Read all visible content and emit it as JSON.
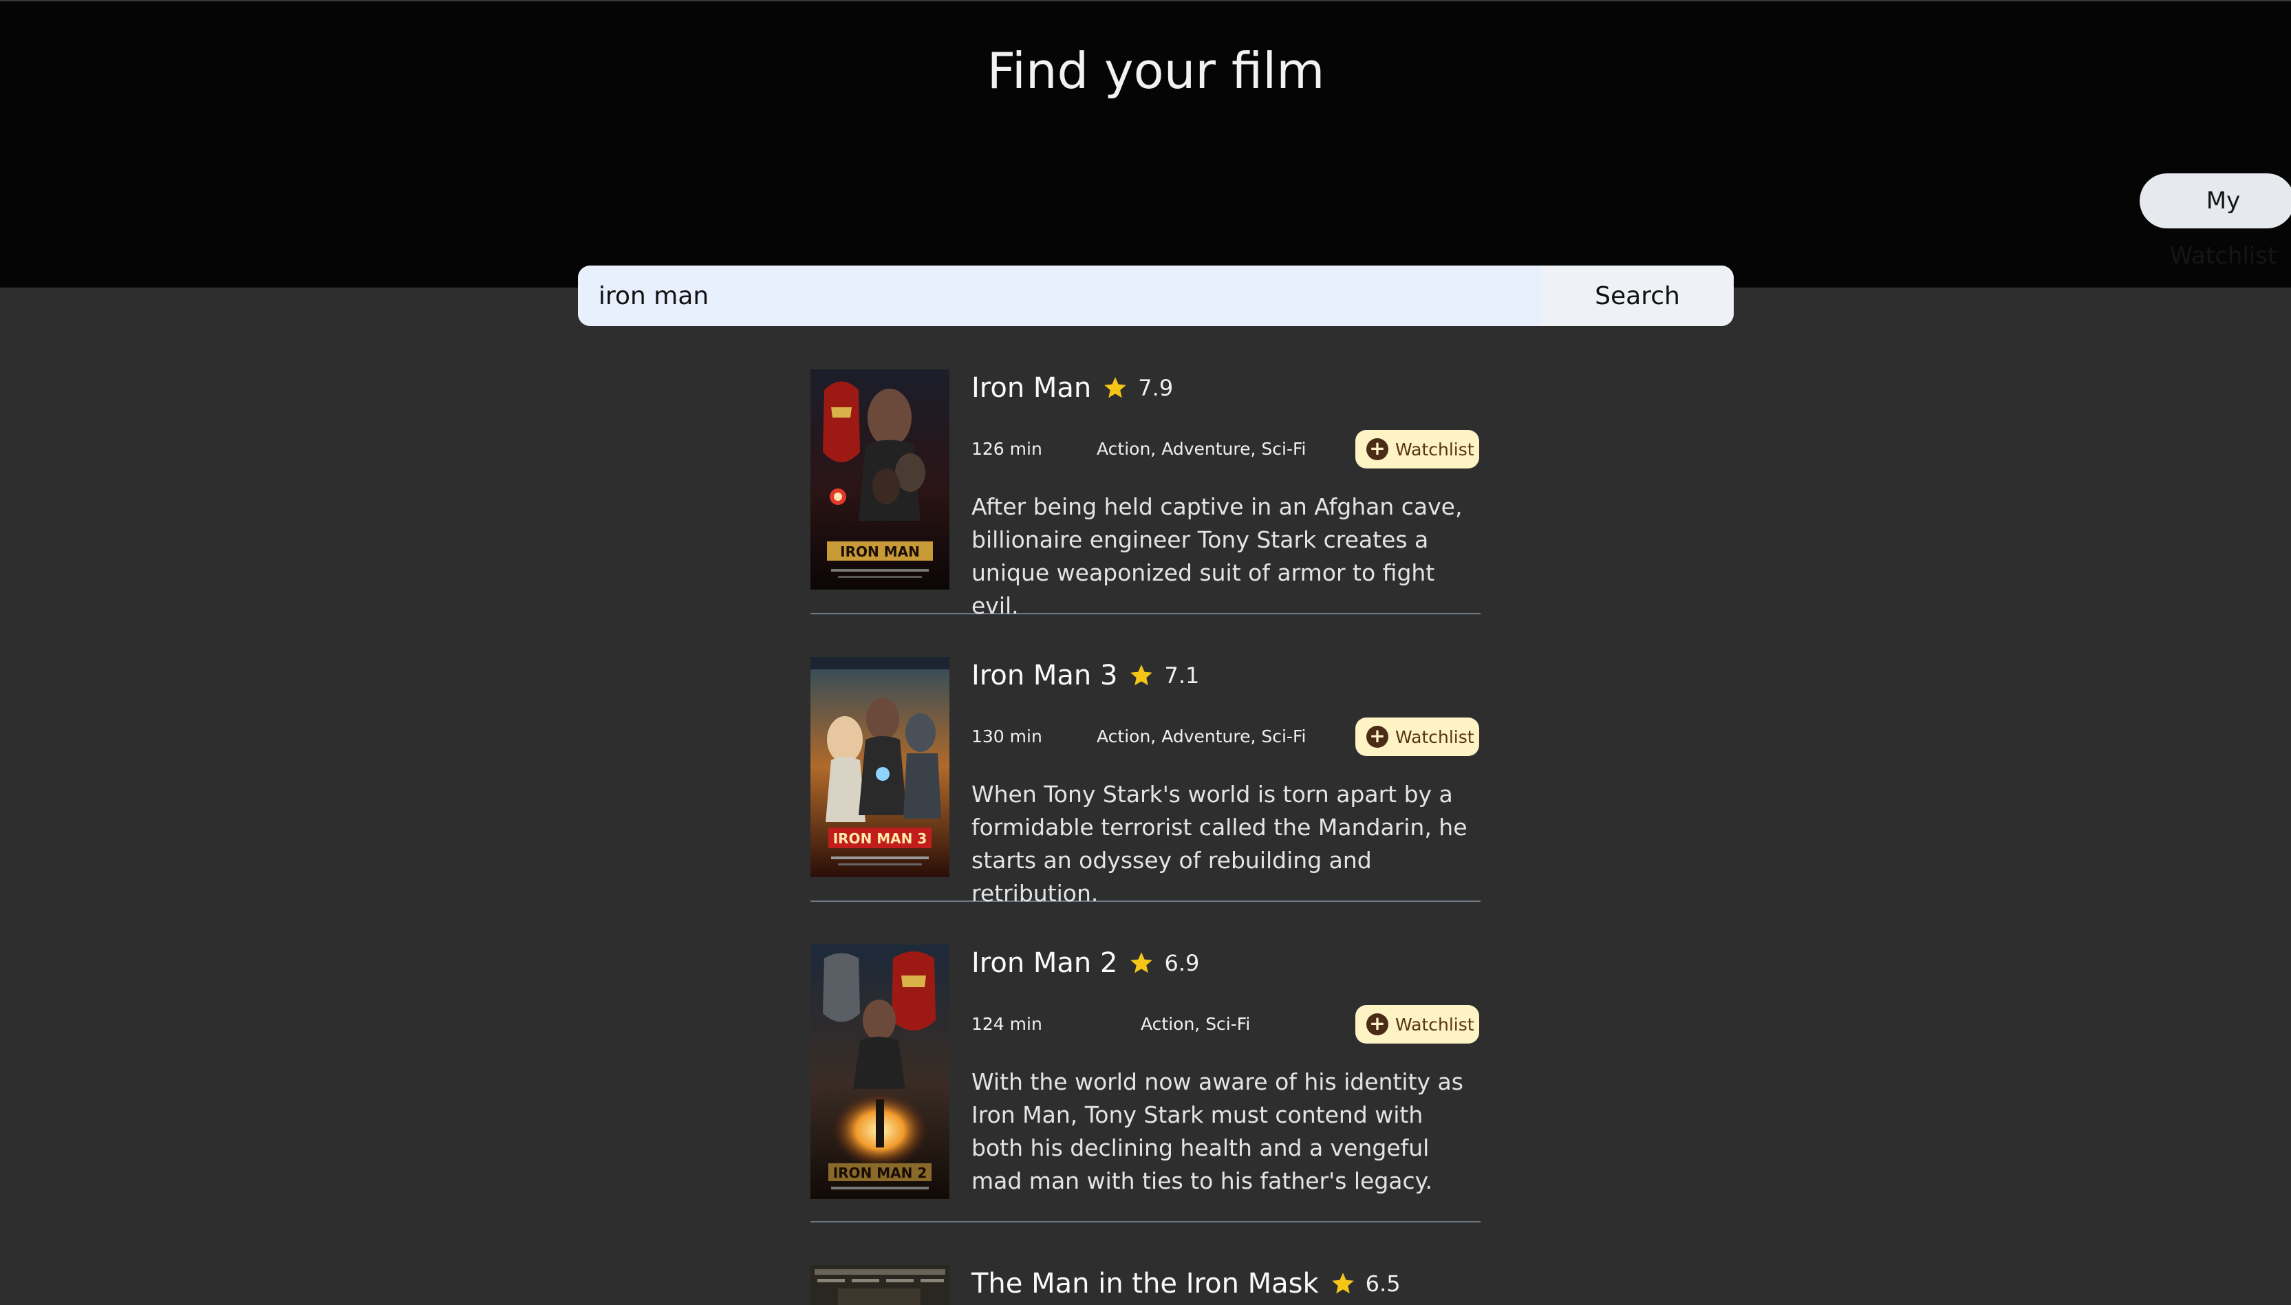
{
  "page": {
    "title": "Find your film",
    "watchlist_button": "My Watchlist"
  },
  "search": {
    "value": "iron man",
    "button_label": "Search"
  },
  "colors": {
    "header_bg": "#050505",
    "page_bg": "#2e2e2e",
    "star": "#f5c518",
    "watchlist_chip_bg": "#fdf3c4"
  },
  "results": [
    {
      "title": "Iron Man",
      "rating": "7.9",
      "runtime": "126 min",
      "genres": "Action, Adventure, Sci-Fi",
      "add_label": "Watchlist",
      "overview": "After being held captive in an Afghan cave, billionaire engineer Tony Stark creates a unique weaponized suit of armor to fight evil.",
      "poster_text": "IRON MAN"
    },
    {
      "title": "Iron Man 3",
      "rating": "7.1",
      "runtime": "130 min",
      "genres": "Action, Adventure, Sci-Fi",
      "add_label": "Watchlist",
      "overview": "When Tony Stark's world is torn apart by a formidable terrorist called the Mandarin, he starts an odyssey of rebuilding and retribution.",
      "poster_text": "IRON MAN 3"
    },
    {
      "title": "Iron Man 2",
      "rating": "6.9",
      "runtime": "124 min",
      "genres": "Action, Sci-Fi",
      "add_label": "Watchlist",
      "overview": "With the world now aware of his identity as Iron Man, Tony Stark must contend with both his declining health and a vengeful mad man with ties to his father's legacy.",
      "poster_text": "IRON MAN 2"
    },
    {
      "title": "The Man in the Iron Mask",
      "rating": "6.5"
    }
  ]
}
